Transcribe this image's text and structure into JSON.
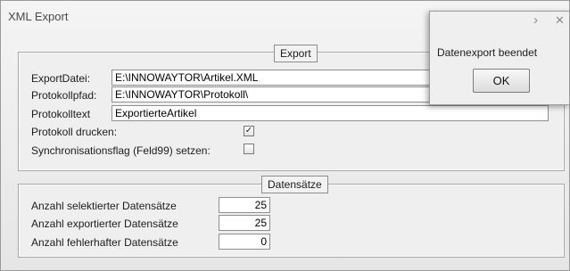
{
  "window": {
    "title": "XML Export"
  },
  "export": {
    "legend": "Export",
    "export_file": {
      "label": "ExportDatei:",
      "value": "E:\\INNOWAYTOR\\Artikel.XML"
    },
    "log_path": {
      "label": "Protokollpfad:",
      "value": "E:\\INNOWAYTOR\\Protokoll\\"
    },
    "log_text": {
      "label": "Protokolltext",
      "value": "ExportierteArtikel"
    },
    "print_log": {
      "label": "Protokoll drucken:",
      "checked": true
    },
    "sync_flag": {
      "label": "Synchronisationsflag (Feld99) setzen:",
      "checked": false
    }
  },
  "records": {
    "legend": "Datensätze",
    "selected": {
      "label": "Anzahl selektierter Datensätze",
      "value": "25"
    },
    "exported": {
      "label": "Anzahl exportierter Datensätze",
      "value": "25"
    },
    "failed": {
      "label": "Anzahl fehlerhafter Datensätze",
      "value": "0"
    }
  },
  "message_box": {
    "text": "Datenexport beendet",
    "ok_label": "OK"
  },
  "icons": {
    "check": "✓",
    "nav": "›",
    "close": "✕"
  }
}
